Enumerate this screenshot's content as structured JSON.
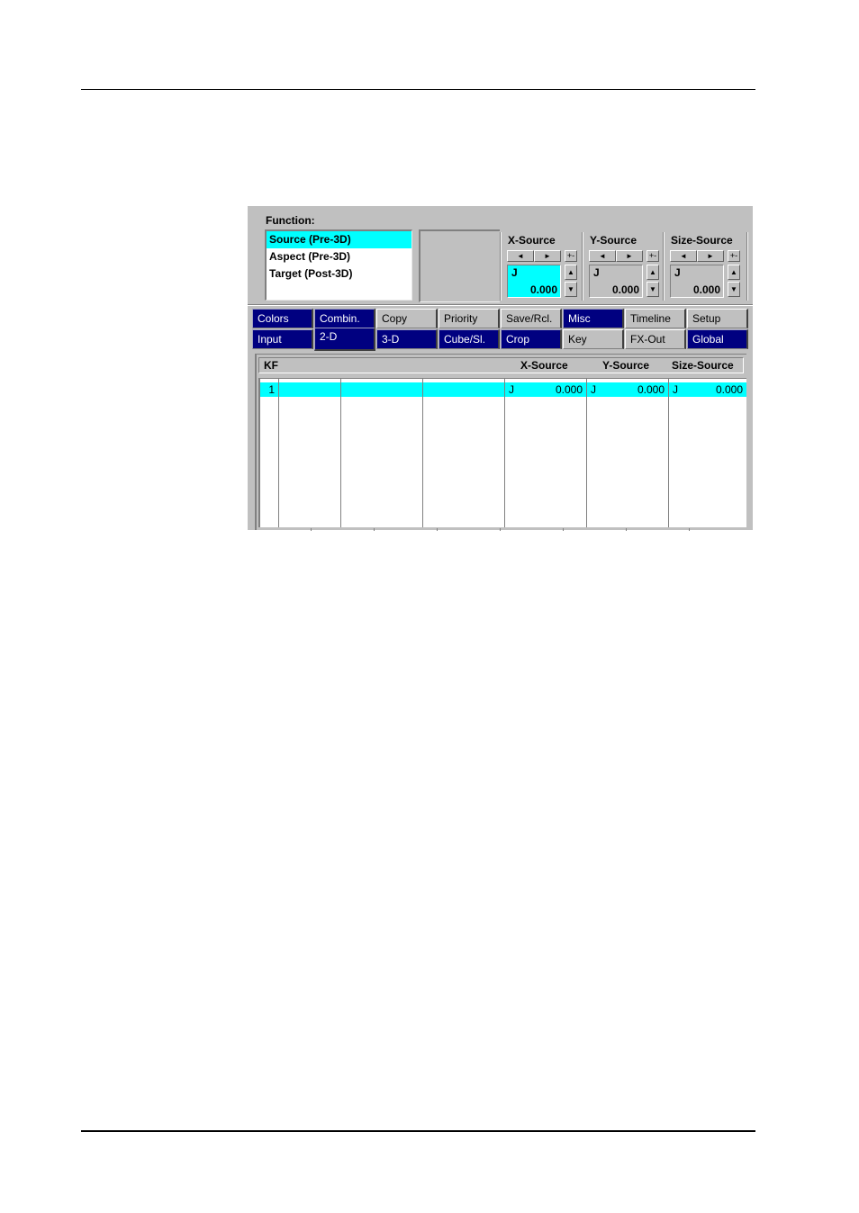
{
  "function_panel": {
    "label": "Function:",
    "items": [
      {
        "label": "Source (Pre-3D)",
        "selected": true
      },
      {
        "label": "Aspect (Pre-3D)",
        "selected": false
      },
      {
        "label": "Target (Post-3D)",
        "selected": false
      }
    ]
  },
  "params": [
    {
      "title": "X-Source",
      "mode": "J",
      "value": "0.000",
      "active": true
    },
    {
      "title": "Y-Source",
      "mode": "J",
      "value": "0.000",
      "active": false
    },
    {
      "title": "Size-Source",
      "mode": "J",
      "value": "0.000",
      "active": false
    }
  ],
  "icons": {
    "left": "◄",
    "right": "►",
    "plusminus": "+-",
    "up": "▲",
    "down": "▼"
  },
  "tabs_row1": [
    {
      "label": "Colors",
      "on": true
    },
    {
      "label": "Combin.",
      "on": true
    },
    {
      "label": "Copy",
      "on": false
    },
    {
      "label": "Priority",
      "on": false
    },
    {
      "label": "Save/Rcl.",
      "on": false
    },
    {
      "label": "Misc",
      "on": true
    },
    {
      "label": "Timeline",
      "on": false
    },
    {
      "label": "Setup",
      "on": false
    }
  ],
  "tabs_row2": [
    {
      "label": "Input",
      "on": true
    },
    {
      "label": "2-D",
      "on": true,
      "selected": true
    },
    {
      "label": "3-D",
      "on": true
    },
    {
      "label": "Cube/Sl.",
      "on": true
    },
    {
      "label": "Crop",
      "on": true
    },
    {
      "label": "Key",
      "on": false
    },
    {
      "label": "FX-Out",
      "on": false
    },
    {
      "label": "Global",
      "on": true
    }
  ],
  "table": {
    "headers": {
      "kf": "KF",
      "x": "X-Source",
      "y": "Y-Source",
      "size": "Size-Source"
    },
    "rows": [
      {
        "kf": "1",
        "x_mode": "J",
        "x": "0.000",
        "y_mode": "J",
        "y": "0.000",
        "size_mode": "J",
        "size": "0.000",
        "selected": true
      }
    ]
  },
  "colors": {
    "accent": "#00ffff",
    "tab_on": "#000080",
    "panel": "#c0c0c0"
  }
}
